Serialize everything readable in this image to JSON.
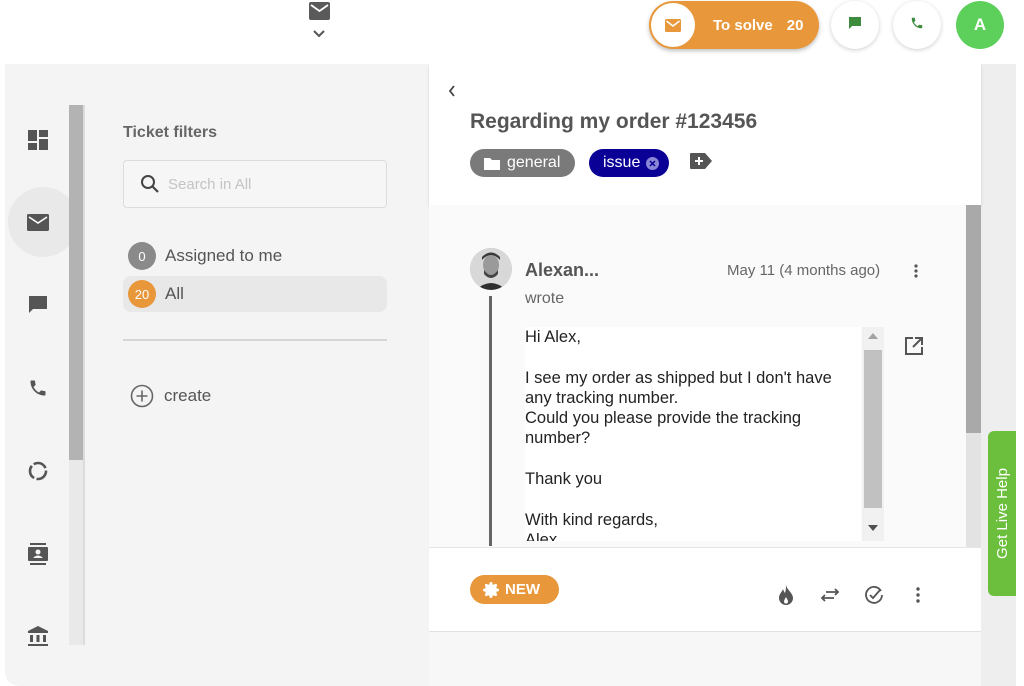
{
  "topbar": {
    "mail_icon": "mail-icon",
    "dropdown_icon": "chevron-down-icon",
    "to_solve": {
      "label": "To solve",
      "count": "20",
      "icon": "mail-icon"
    },
    "chat_button_icon": "chat-icon",
    "phone_button_icon": "phone-icon",
    "user_avatar_initial": "A"
  },
  "colors": {
    "accent_orange": "#e8973a",
    "tag_issue": "#0a0096",
    "tag_general": "#7a7a7a",
    "avatar_green": "#5cd05a",
    "live_help_green": "#6cbf3c"
  },
  "nav": {
    "items": [
      {
        "icon": "dashboard-icon",
        "active": false
      },
      {
        "icon": "mail-icon",
        "active": true
      },
      {
        "icon": "chat-icon",
        "active": false
      },
      {
        "icon": "phone-icon",
        "active": false
      },
      {
        "icon": "reports-icon",
        "active": false
      },
      {
        "icon": "contacts-icon",
        "active": false
      },
      {
        "icon": "bank-icon",
        "active": false
      }
    ]
  },
  "filters": {
    "title": "Ticket filters",
    "search_placeholder": "Search in All",
    "search_value": "",
    "items": [
      {
        "label": "Assigned to me",
        "count": "0",
        "active": false
      },
      {
        "label": "All",
        "count": "20",
        "active": true
      }
    ],
    "create_label": "create"
  },
  "ticket": {
    "title": "Regarding my order #123456",
    "tags": [
      {
        "label": "general",
        "icon": "folder-icon"
      },
      {
        "label": "issue",
        "removable": true
      }
    ],
    "message": {
      "author": "Alexan...",
      "action": "wrote",
      "date": "May 11 (4 months ago)",
      "body": "Hi Alex,\n\nI see my order as shipped but I don't have any tracking number.\nCould you please provide the tracking number?\n\nThank you\n\nWith kind regards,\nAlex"
    },
    "status": "NEW",
    "actions": [
      "priority-icon",
      "transfer-icon",
      "resolve-icon",
      "more-icon"
    ]
  },
  "live_help": {
    "label": "Get Live Help"
  }
}
